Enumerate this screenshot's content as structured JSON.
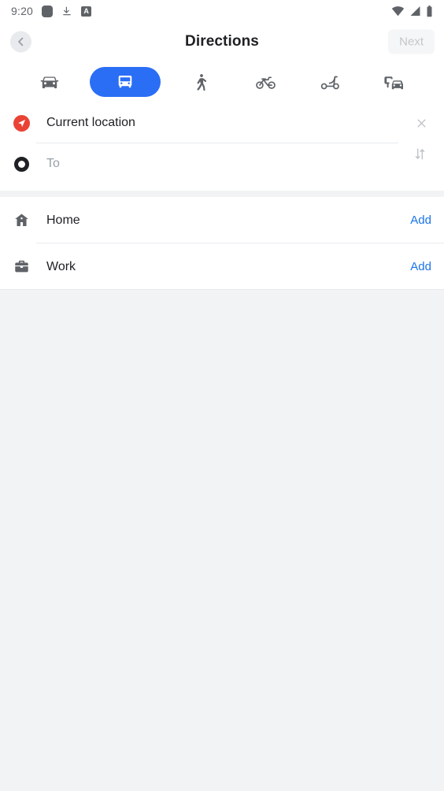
{
  "status_bar": {
    "time": "9:20",
    "left_icons": [
      {
        "name": "app-square-icon",
        "glyph": "square"
      },
      {
        "name": "download-icon",
        "glyph": "download"
      },
      {
        "name": "a-badge-icon",
        "glyph": "A"
      }
    ],
    "right_icons": [
      {
        "name": "wifi-icon"
      },
      {
        "name": "cell-signal-icon"
      },
      {
        "name": "battery-icon"
      }
    ]
  },
  "header": {
    "back_label": "Back",
    "title": "Directions",
    "next_label": "Next",
    "next_enabled": false
  },
  "travel_modes": [
    {
      "id": "driving",
      "label": "Driving",
      "icon": "car-icon",
      "selected": false
    },
    {
      "id": "transit",
      "label": "Transit",
      "icon": "bus-icon",
      "selected": true
    },
    {
      "id": "walking",
      "label": "Walking",
      "icon": "walk-icon",
      "selected": false
    },
    {
      "id": "cycling",
      "label": "Cycling",
      "icon": "bicycle-icon",
      "selected": false
    },
    {
      "id": "two-wheeler",
      "label": "Scooter",
      "icon": "scooter-icon",
      "selected": false
    },
    {
      "id": "rideshare",
      "label": "Rideshare",
      "icon": "rideshare-icon",
      "selected": false
    }
  ],
  "route": {
    "from": {
      "icon": "navigation-arrow-icon",
      "value": "Current location",
      "clear_icon": "close-icon"
    },
    "to": {
      "icon": "destination-ring-icon",
      "value": "",
      "placeholder": "To"
    },
    "swap_icon": "swap-vertical-icon"
  },
  "shortcuts": [
    {
      "icon": "home-icon",
      "label": "Home",
      "action": "Add"
    },
    {
      "icon": "briefcase-icon",
      "label": "Work",
      "action": "Add"
    }
  ],
  "colors": {
    "accent_blue": "#1a73e8",
    "selected_pill": "#2a6ef5",
    "from_marker_red": "#ea4335",
    "icon_gray": "#5f6368",
    "page_bg": "#f1f3f4"
  }
}
